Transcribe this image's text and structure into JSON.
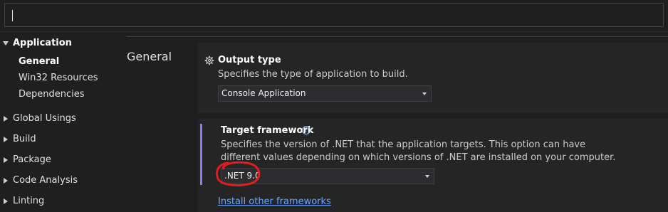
{
  "search": {
    "value": ""
  },
  "nav": {
    "items": [
      {
        "label": "Application"
      },
      {
        "label": "General"
      },
      {
        "label": "Win32 Resources"
      },
      {
        "label": "Dependencies"
      },
      {
        "label": "Global Usings"
      },
      {
        "label": "Build"
      },
      {
        "label": "Package"
      },
      {
        "label": "Code Analysis"
      },
      {
        "label": "Linting"
      }
    ]
  },
  "main": {
    "section_title": "General",
    "output_type": {
      "title": "Output type",
      "description": "Specifies the type of application to build.",
      "selected": "Console Application",
      "icon": "gear-icon"
    },
    "target_framework": {
      "title": "Target framework",
      "description_line1": "Specifies the version of .NET that the application targets. This option can have",
      "description_line2": "different values depending on which versions of .NET are installed on your computer.",
      "selected": ".NET 9.0",
      "icon": "info-icon"
    },
    "install_link": "Install other frameworks"
  },
  "colors": {
    "background": "#1f1f1f",
    "panel": "#252526",
    "accent": "#8b7cf6",
    "link": "#6aa5ff",
    "annotation": "#e01e1e"
  }
}
